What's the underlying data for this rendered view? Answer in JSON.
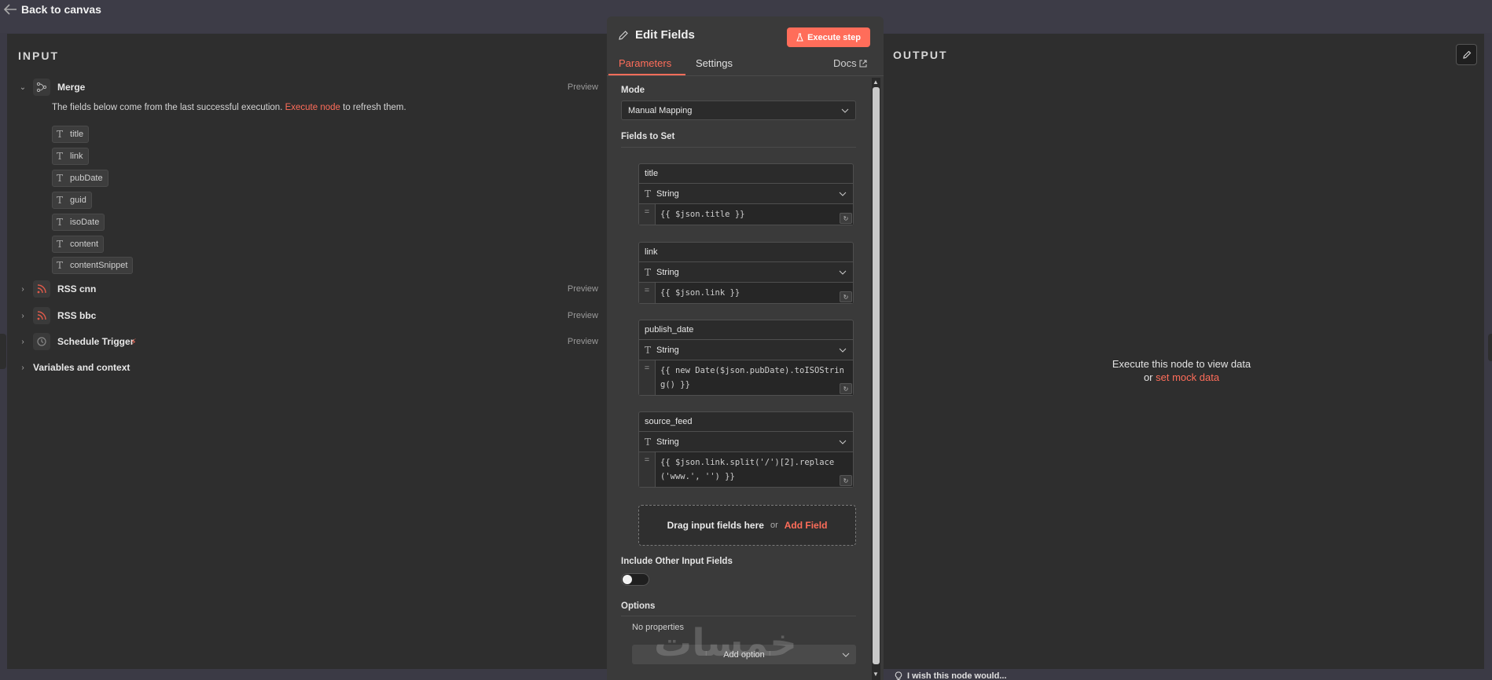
{
  "topbar": {
    "back_label": "Back to canvas"
  },
  "input_panel": {
    "title": "INPUT",
    "hint_before": "The fields below come from the last successful execution.",
    "hint_link": "Execute node",
    "hint_after": "to refresh them.",
    "nodes": [
      {
        "label": "Merge",
        "preview": "Preview",
        "icon": "merge-icon",
        "expanded": true
      },
      {
        "label": "RSS cnn",
        "preview": "Preview",
        "icon": "rss-icon"
      },
      {
        "label": "RSS bbc",
        "preview": "Preview",
        "icon": "rss-icon"
      },
      {
        "label": "Schedule Trigger",
        "preview": "Preview",
        "icon": "clock-icon"
      },
      {
        "label": "Variables and context"
      }
    ],
    "fields": [
      "title",
      "link",
      "pubDate",
      "guid",
      "isoDate",
      "content",
      "contentSnippet"
    ]
  },
  "modal": {
    "title": "Edit Fields",
    "execute_label": "Execute step",
    "tabs": {
      "parameters": "Parameters",
      "settings": "Settings",
      "docs": "Docs"
    },
    "mode_label": "Mode",
    "mode_value": "Manual Mapping",
    "fields_to_set_label": "Fields to Set",
    "assignments": [
      {
        "name": "title",
        "type": "String",
        "value": "{{ $json.title }}"
      },
      {
        "name": "link",
        "type": "String",
        "value": "{{ $json.link }}"
      },
      {
        "name": "publish_date",
        "type": "String",
        "value": "{{ new Date($json.pubDate).toISOString() }}"
      },
      {
        "name": "source_feed",
        "type": "String",
        "value": "{{ $json.link.split('/')[2].replace('www.', '') }}"
      }
    ],
    "dropzone": {
      "text": "Drag input fields here",
      "or": "or",
      "add": "Add Field"
    },
    "include_other_label": "Include Other Input Fields",
    "include_other_value": false,
    "options_label": "Options",
    "no_properties": "No properties",
    "add_option": "Add option",
    "watermark": "خمسات"
  },
  "output_panel": {
    "title": "OUTPUT",
    "empty_line1": "Execute this node to view data",
    "empty_or": "or",
    "empty_link": "set mock data",
    "wish_text": "I wish this node would..."
  },
  "colors": {
    "accent": "#ff6d5a",
    "panel": "#2e2e2e",
    "background": "#3b3a45"
  }
}
